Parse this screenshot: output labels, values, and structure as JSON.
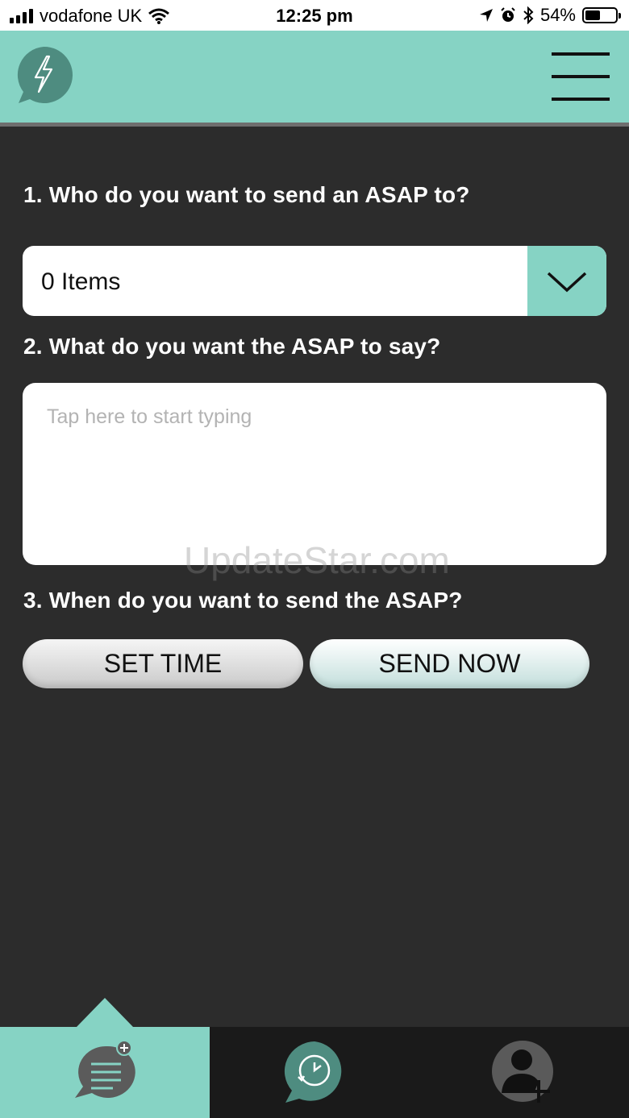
{
  "status_bar": {
    "carrier": "vodafone UK",
    "time": "12:25 pm",
    "battery_percent": "54%",
    "battery_level": 0.54
  },
  "header": {
    "logo_icon": "lightning-speech-bubble-icon",
    "menu_icon": "hamburger-menu-icon"
  },
  "form": {
    "q1": "1. Who do you want to send an ASAP to?",
    "recipients_value": "0 Items",
    "q2": "2. What do you want the ASAP to say?",
    "message_placeholder": "Tap here to start typing",
    "q3": "3. When do you want to send the ASAP?",
    "set_time_label": "SET TIME",
    "send_now_label": "SEND NOW"
  },
  "watermark": "UpdateStar.com",
  "bottom_nav": {
    "items": [
      {
        "icon": "compose-message-icon",
        "active": true
      },
      {
        "icon": "scheduled-history-icon",
        "active": false
      },
      {
        "icon": "add-contact-icon",
        "active": false
      }
    ]
  },
  "colors": {
    "accent": "#86d3c4",
    "background": "#2c2c2c",
    "icon_dark": "#4e8c80"
  }
}
